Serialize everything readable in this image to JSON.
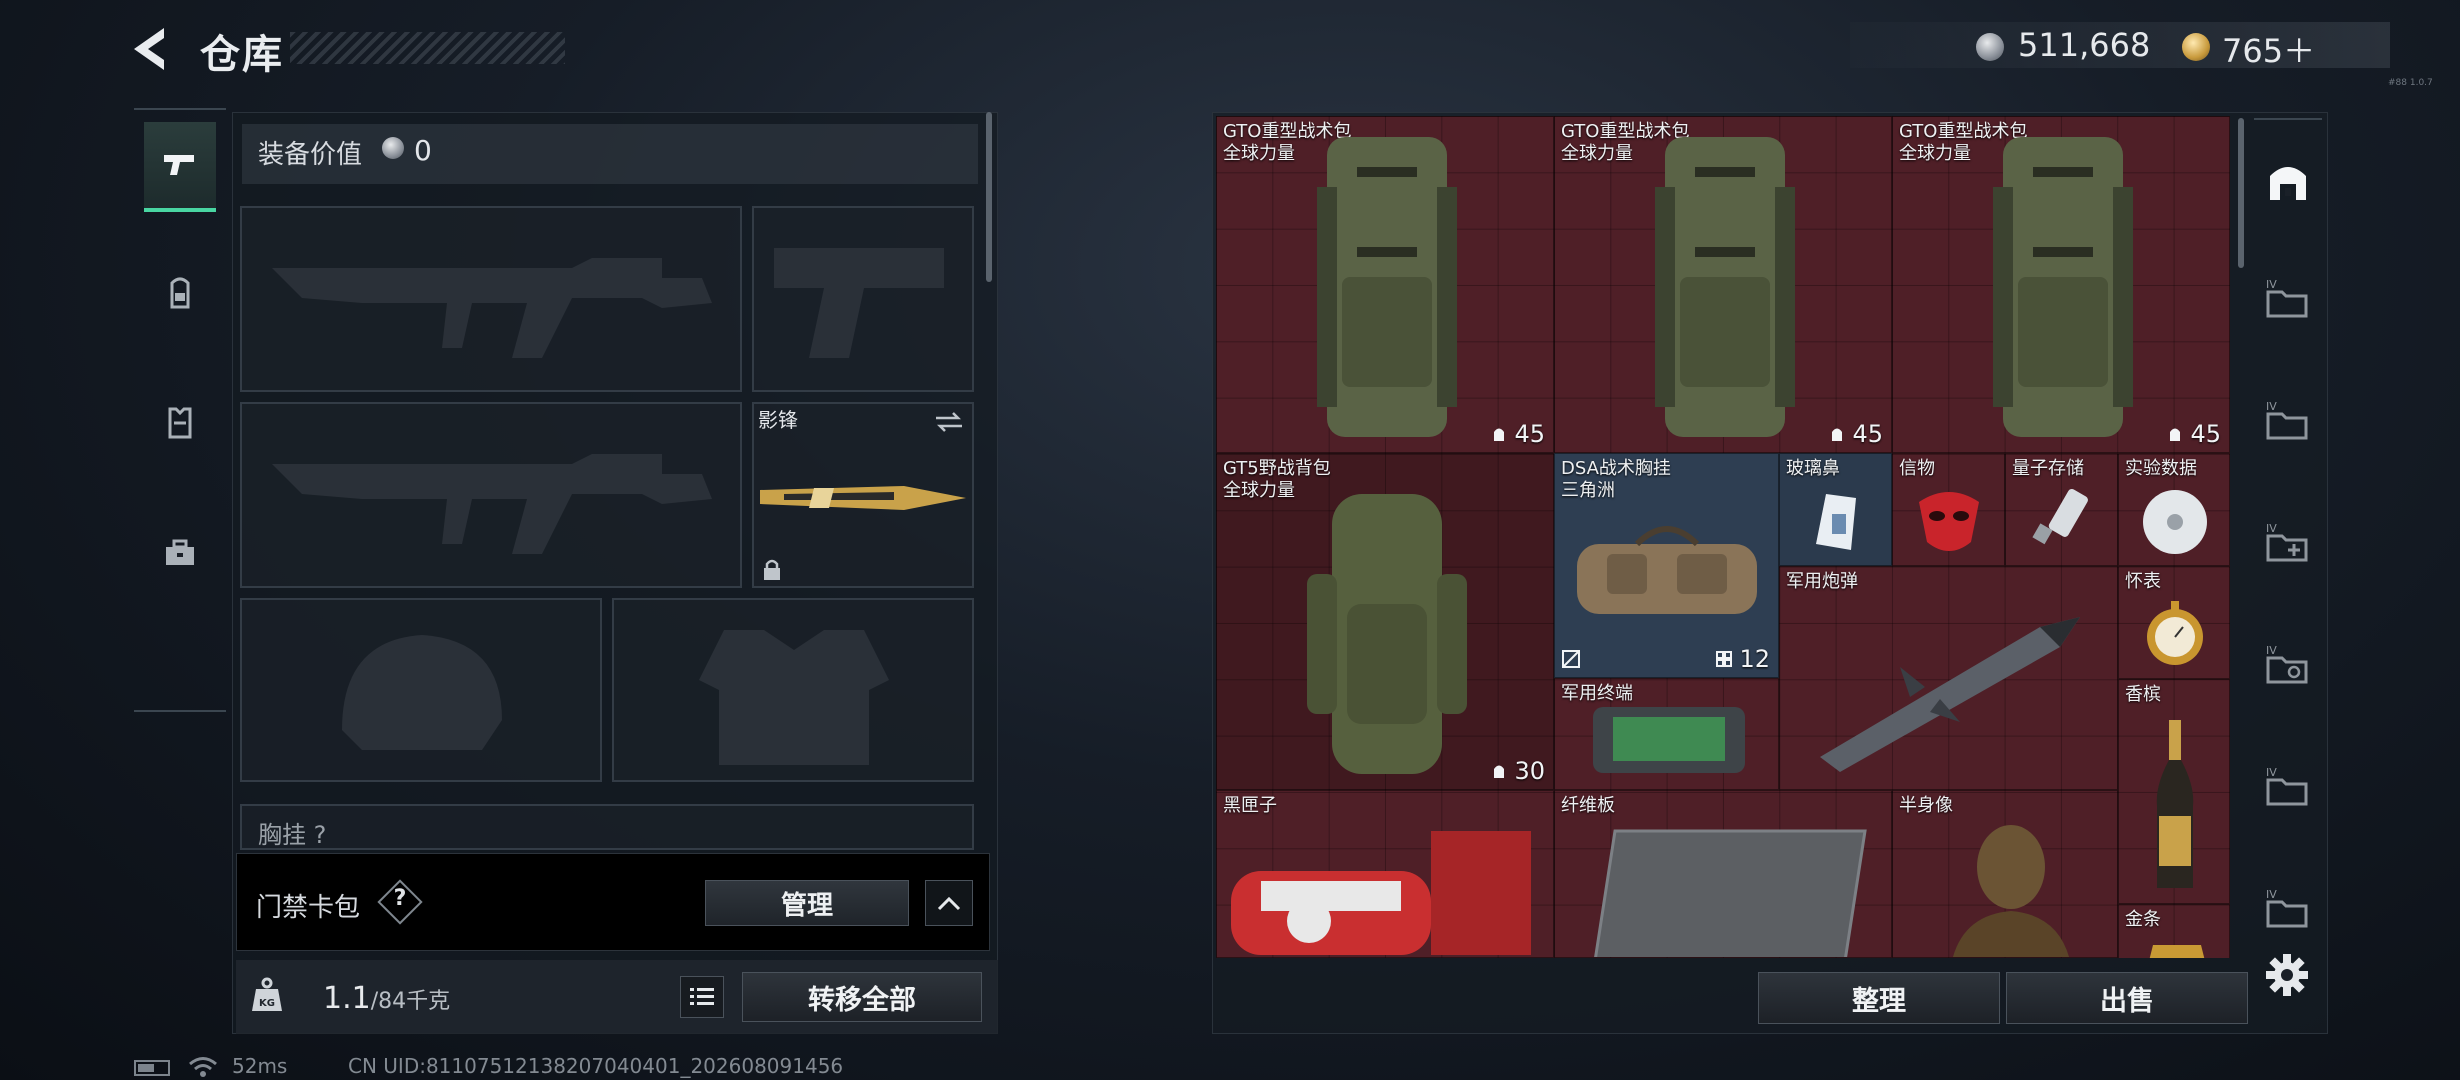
{
  "header": {
    "title": "仓库",
    "back_icon": "chevron-left-icon"
  },
  "currency": {
    "silver_value": "511,668",
    "gold_value": "765＋",
    "version": "#88 1.0.7"
  },
  "loadout": {
    "equipment_value_label": "装备价值",
    "equipment_value": "0",
    "knife_name": "影锋",
    "chest_label": "胸挂 ?",
    "keycard_label": "门禁卡包",
    "help_mark": "?",
    "manage_label": "管理",
    "weight_value": "1.1",
    "weight_max": "/84千克",
    "transfer_all_label": "转移全部"
  },
  "stash": {
    "items": [
      {
        "name": "GTO重型战术包",
        "sub": "全球力量",
        "count": "45",
        "count_icon": "capacity-icon"
      },
      {
        "name": "GTO重型战术包",
        "sub": "全球力量",
        "count": "45",
        "count_icon": "capacity-icon"
      },
      {
        "name": "GTO重型战术包",
        "sub": "全球力量",
        "count": "45",
        "count_icon": "capacity-icon"
      },
      {
        "name": "GT5野战背包",
        "sub": "全球力量",
        "count": "30",
        "count_icon": "capacity-icon"
      },
      {
        "name": "DSA战术胸挂",
        "sub": "三角洲",
        "count": "12",
        "count_icon": "slots-icon"
      },
      {
        "name": "玻璃鼻",
        "sub": ""
      },
      {
        "name": "信物",
        "sub": ""
      },
      {
        "name": "量子存储",
        "sub": ""
      },
      {
        "name": "实验数据",
        "sub": ""
      },
      {
        "name": "军用炮弹",
        "sub": ""
      },
      {
        "name": "怀表",
        "sub": ""
      },
      {
        "name": "军用终端",
        "sub": ""
      },
      {
        "name": "香槟",
        "sub": ""
      },
      {
        "name": "黑匣子",
        "sub": ""
      },
      {
        "name": "纤维板",
        "sub": ""
      },
      {
        "name": "半身像",
        "sub": ""
      },
      {
        "name": "金条",
        "sub": ""
      }
    ],
    "sort_label": "整理",
    "sell_label": "出售"
  },
  "status_bar": {
    "ping": "52ms",
    "uid": "CN UID:8110751213820704040​1_202608091456"
  },
  "colors": {
    "accent": "#49d6a2",
    "stash_bg": "#4f1f27",
    "chest_rig_bg": "#2e3e52"
  }
}
